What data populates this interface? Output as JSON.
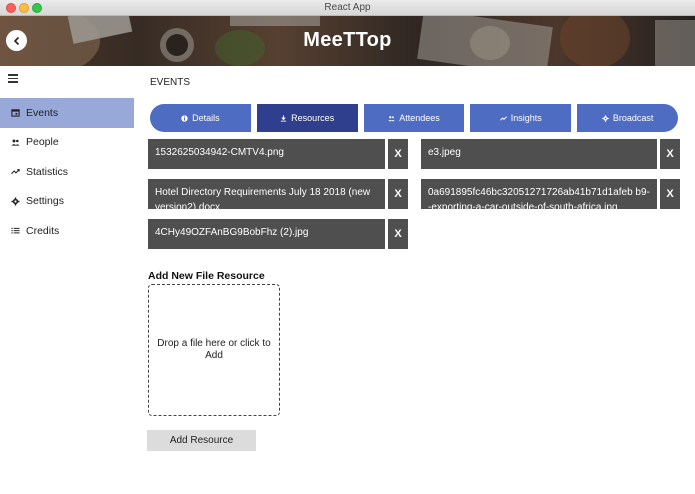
{
  "window": {
    "title": "React App"
  },
  "header": {
    "brand": "MeeTTop"
  },
  "sidebar": {
    "items": [
      {
        "label": "Events",
        "icon": "calendar-icon",
        "active": true
      },
      {
        "label": "People",
        "icon": "people-icon",
        "active": false
      },
      {
        "label": "Statistics",
        "icon": "trend-icon",
        "active": false
      },
      {
        "label": "Settings",
        "icon": "gear-icon",
        "active": false
      },
      {
        "label": "Credits",
        "icon": "list-icon",
        "active": false
      }
    ]
  },
  "main": {
    "title": "EVENTS",
    "tabs": [
      {
        "label": "Details",
        "icon": "info-icon"
      },
      {
        "label": "Resources",
        "icon": "download-icon",
        "active": true
      },
      {
        "label": "Attendees",
        "icon": "people-icon"
      },
      {
        "label": "Insights",
        "icon": "trend-icon"
      },
      {
        "label": "Broadcast",
        "icon": "gear-icon"
      }
    ],
    "files": [
      {
        "name": "1532625034942-CMTV4.png",
        "remove": "X"
      },
      {
        "name": "e3.jpeg",
        "remove": "X"
      },
      {
        "name": "Hotel Directory Requirements July 18 2018 (new version2).docx",
        "remove": "X"
      },
      {
        "name": "0a691895fc46bc32051271726ab41b71d1afeb b9--exporting-a-car-outside-of-south-africa.jpg",
        "remove": "X"
      },
      {
        "name": "4CHy49OZFAnBG9BobFhz (2).jpg",
        "remove": "X"
      }
    ],
    "add_section": {
      "title": "Add New File Resource",
      "dropzone_text": "Drop a file here or click to Add",
      "button_label": "Add Resource"
    }
  },
  "colors": {
    "accent": "#4f6cc3",
    "accent_active": "#2f3f8e",
    "sidebar_active": "#97a8d9",
    "file_bg": "#4f4f4f"
  }
}
